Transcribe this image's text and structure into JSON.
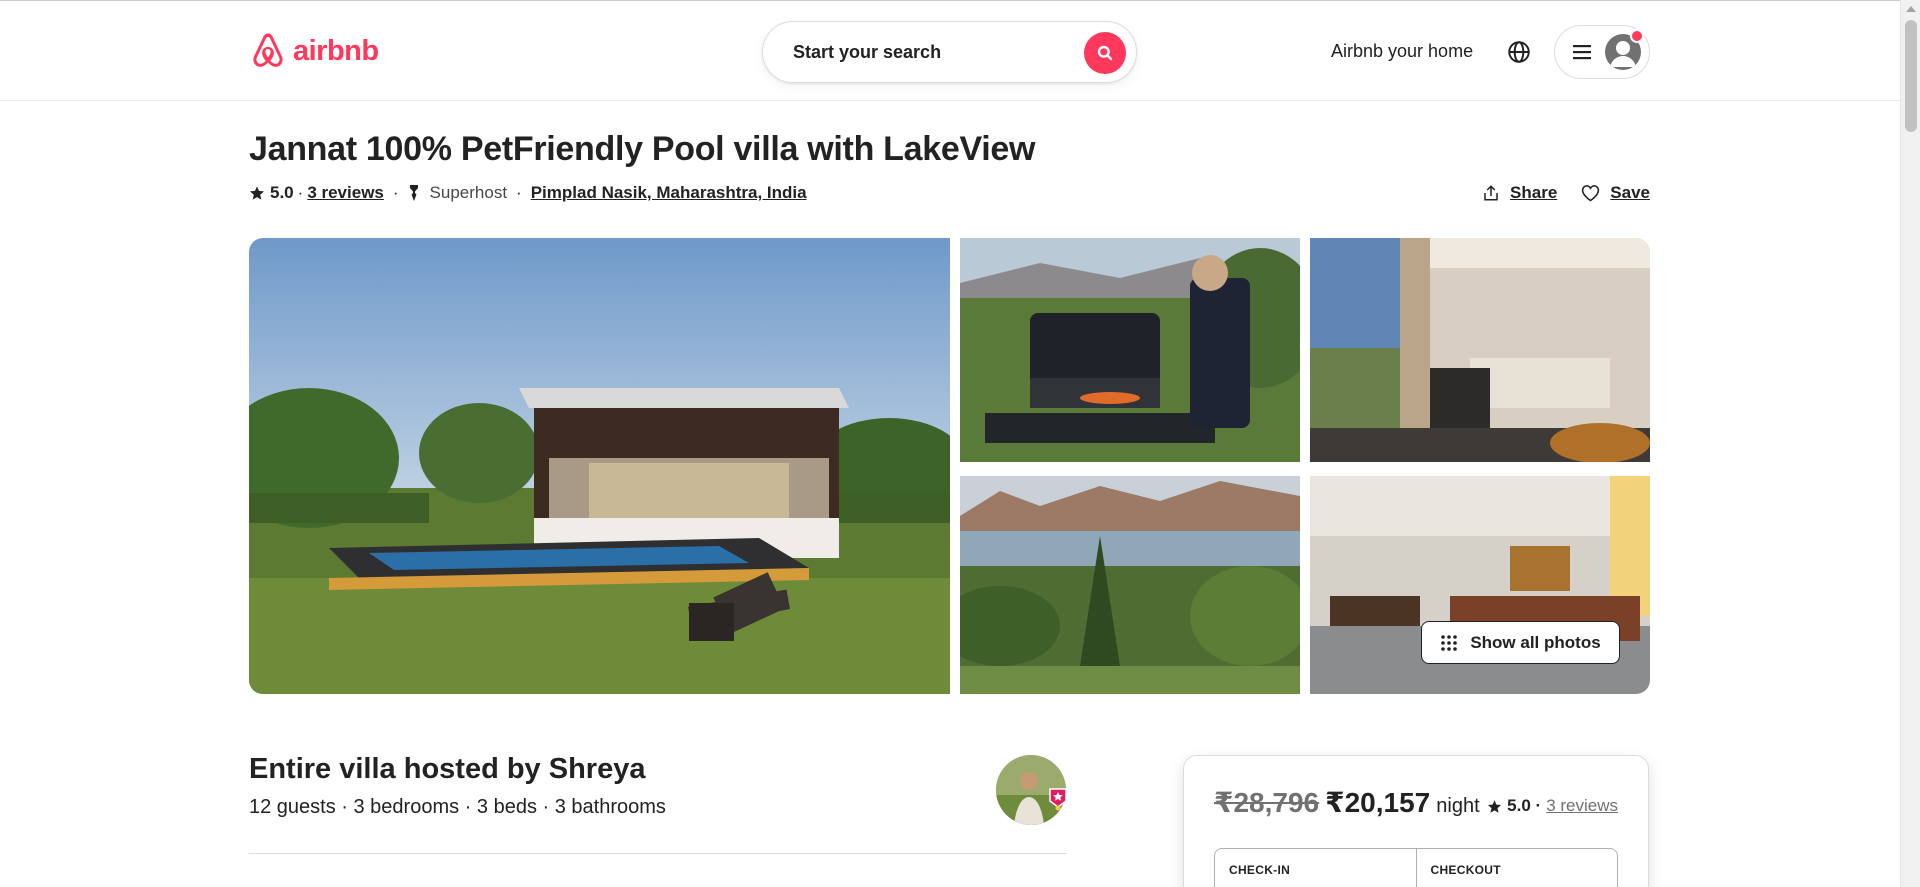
{
  "header": {
    "brand": "airbnb",
    "search_placeholder": "Start your search",
    "host_link": "Airbnb your home"
  },
  "listing": {
    "title": "Jannat 100% PetFriendly Pool villa with LakeView",
    "rating": "5.0",
    "reviews": "3 reviews",
    "host_badge": "Superhost",
    "location": "Pimplad Nasik, Maharashtra, India",
    "share_label": "Share",
    "save_label": "Save",
    "show_all_photos": "Show all photos"
  },
  "host": {
    "title": "Entire villa hosted by Shreya",
    "summary": "12 guests · 3 bedrooms · 3 beds · 3 bathrooms"
  },
  "booking": {
    "old_price": "₹28,796",
    "new_price": "₹20,157",
    "per": "night",
    "rating": "5.0 ·",
    "reviews": "3 reviews",
    "checkin_label": "CHECK-IN",
    "checkin_value": "",
    "checkout_label": "CHECKOUT",
    "checkout_value": ""
  },
  "colors": {
    "brand": "#FF385C",
    "text": "#222222",
    "muted": "#717171"
  }
}
